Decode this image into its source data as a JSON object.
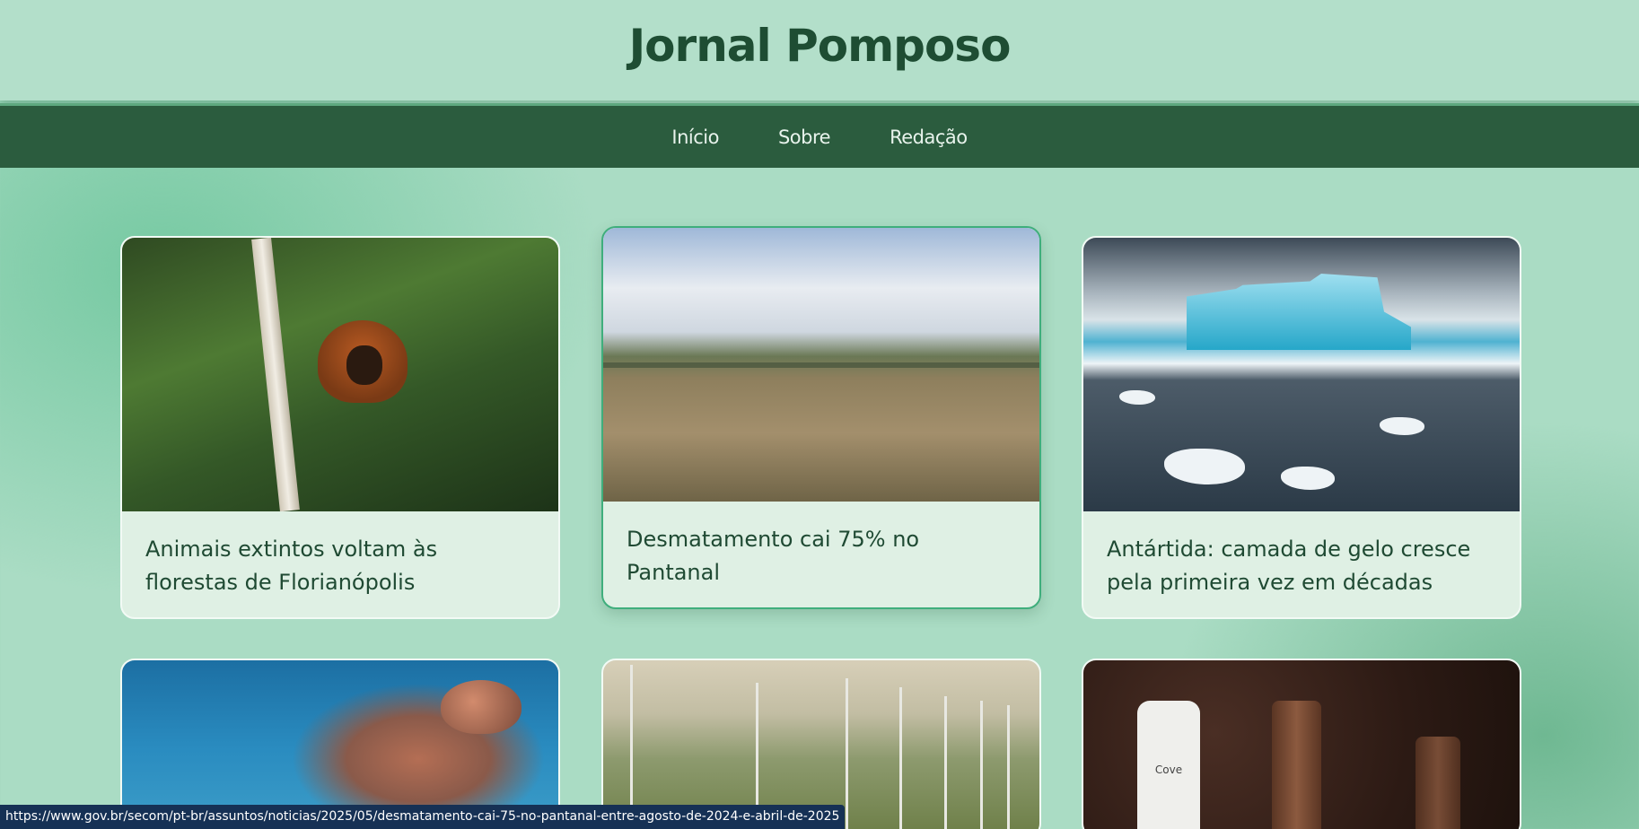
{
  "header": {
    "title": "Jornal Pomposo"
  },
  "nav": {
    "items": [
      "Início",
      "Sobre",
      "Redação"
    ]
  },
  "cards": [
    {
      "title": "Animais extintos voltam às florestas de Florianópolis",
      "image": "monkey-in-forest"
    },
    {
      "title": "Desmatamento cai 75% no Pantanal",
      "image": "pantanal-grassland"
    },
    {
      "title": "Antártida: camada de gelo cresce pela primeira vez em décadas",
      "image": "antarctic-iceberg"
    },
    {
      "title": "",
      "image": "sea-turtle"
    },
    {
      "title": "",
      "image": "wind-turbines"
    },
    {
      "title": "",
      "image": "compostable-bottles"
    }
  ],
  "bottle_label": "Cove",
  "status_bar": {
    "url": "https://www.gov.br/secom/pt-br/assuntos/noticias/2025/05/desmatamento-cai-75-no-pantanal-entre-agosto-de-2024-e-abril-de-2025"
  }
}
